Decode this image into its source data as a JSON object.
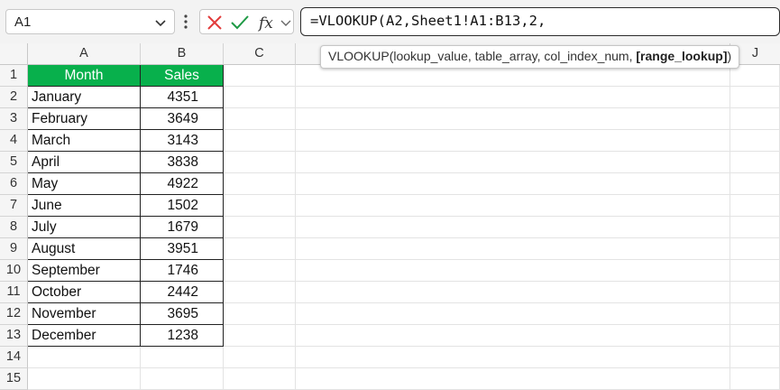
{
  "name_box": {
    "value": "A1"
  },
  "formula_bar": {
    "formula": "=VLOOKUP(A2,Sheet1!A1:B13,2,",
    "cancel_icon": "close-icon",
    "enter_icon": "check-icon",
    "function_icon": "fx-icon"
  },
  "tooltip": {
    "prefix": "VLOOKUP(lookup_value, table_array, col_index_num, ",
    "bold_arg": "[range_lookup]",
    "suffix": ")"
  },
  "columns": [
    "A",
    "B",
    "C",
    "J"
  ],
  "rows": [
    "1",
    "2",
    "3",
    "4",
    "5",
    "6",
    "7",
    "8",
    "9",
    "10",
    "11",
    "12",
    "13",
    "14",
    "15"
  ],
  "table": {
    "headers": [
      "Month",
      "Sales"
    ],
    "rows": [
      [
        "January",
        "4351"
      ],
      [
        "February",
        "3649"
      ],
      [
        "March",
        "3143"
      ],
      [
        "April",
        "3838"
      ],
      [
        "May",
        "4922"
      ],
      [
        "June",
        "1502"
      ],
      [
        "July",
        "1679"
      ],
      [
        "August",
        "3951"
      ],
      [
        "September",
        "1746"
      ],
      [
        "October",
        "2442"
      ],
      [
        "November",
        "3695"
      ],
      [
        "December",
        "1238"
      ]
    ]
  },
  "colors": {
    "header_fill": "#08b04c",
    "cancel": "#e23b3b",
    "enter": "#1e9a45"
  }
}
